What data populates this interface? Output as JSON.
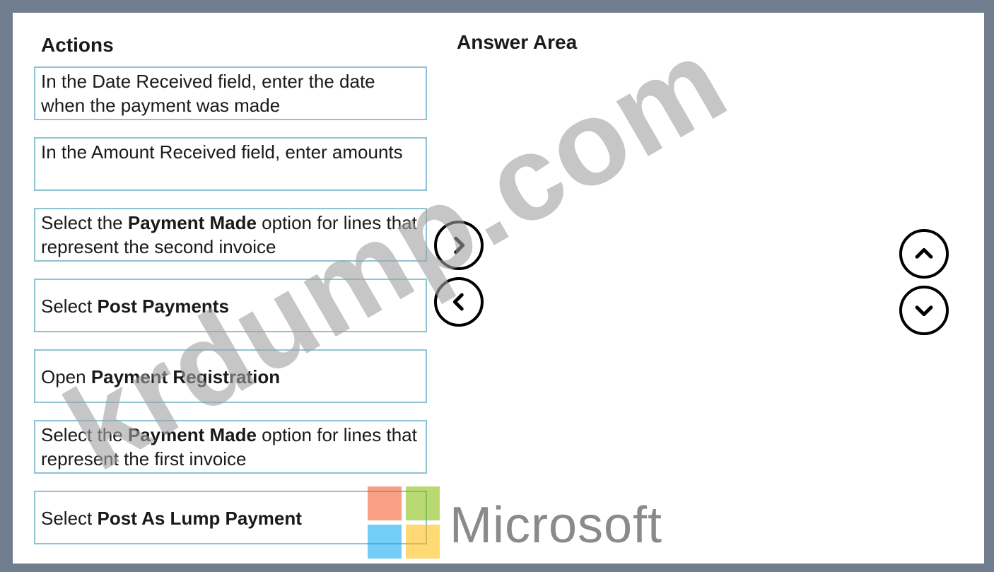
{
  "actions": {
    "heading": "Actions",
    "items": [
      {
        "parts": [
          {
            "text": "In the Date Received field, enter the date when the payment was made",
            "bold": false
          }
        ]
      },
      {
        "parts": [
          {
            "text": "In the Amount Received field, enter amounts",
            "bold": false
          }
        ]
      },
      {
        "parts": [
          {
            "text": "Select the ",
            "bold": false
          },
          {
            "text": "Payment Made",
            "bold": true
          },
          {
            "text": " option for lines that represent the second invoice",
            "bold": false
          }
        ]
      },
      {
        "parts": [
          {
            "text": "Select ",
            "bold": false
          },
          {
            "text": "Post Payments",
            "bold": true
          }
        ]
      },
      {
        "parts": [
          {
            "text": "Open ",
            "bold": false
          },
          {
            "text": "Payment Registration",
            "bold": true
          }
        ]
      },
      {
        "parts": [
          {
            "text": "Select the ",
            "bold": false
          },
          {
            "text": "Payment Made",
            "bold": true
          },
          {
            "text": " option for lines that represent the first invoice",
            "bold": false
          }
        ]
      },
      {
        "parts": [
          {
            "text": "Select ",
            "bold": false
          },
          {
            "text": "Post As Lump Payment",
            "bold": true
          }
        ]
      }
    ]
  },
  "answer_area": {
    "heading": "Answer Area"
  },
  "controls": {
    "move_right_icon": "chevron-right-icon",
    "move_left_icon": "chevron-left-icon",
    "move_up_icon": "chevron-up-icon",
    "move_down_icon": "chevron-down-icon"
  },
  "watermark": "krdump.com",
  "brand": {
    "name": "Microsoft",
    "colors": [
      "#f25022",
      "#7fba00",
      "#00a4ef",
      "#ffb900"
    ]
  }
}
